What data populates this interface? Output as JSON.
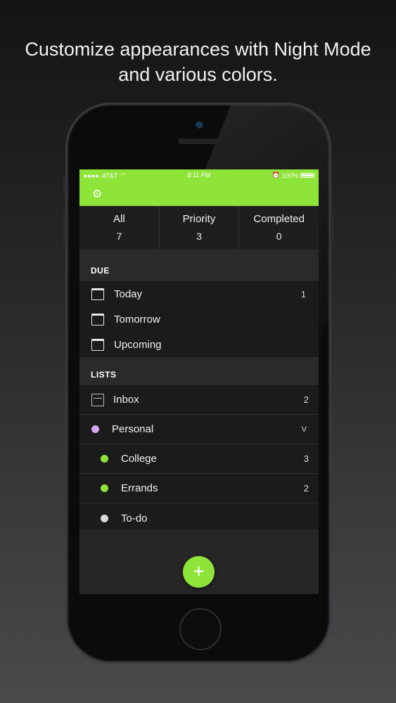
{
  "headline": {
    "line1": "Customize appearances with Night Mode",
    "line2": "and various colors."
  },
  "status_bar": {
    "signal": "●●●●",
    "carrier": "AT&T",
    "wifi_icon": "wifi-icon",
    "time": "8:11 PM",
    "alarm_icon": "alarm-icon",
    "battery": "100%"
  },
  "app_bar": {
    "settings_icon": "⚙"
  },
  "filters": [
    {
      "label": "All",
      "count": "7"
    },
    {
      "label": "Priority",
      "count": "3"
    },
    {
      "label": "Completed",
      "count": "0"
    }
  ],
  "due": {
    "header": "DUE",
    "items": [
      {
        "label": "Today",
        "count": "1"
      },
      {
        "label": "Tomorrow",
        "count": ""
      },
      {
        "label": "Upcoming",
        "count": ""
      }
    ]
  },
  "lists": {
    "header": "LISTS",
    "items": [
      {
        "label": "Inbox",
        "count": "2"
      },
      {
        "label": "Personal",
        "chevron": "V",
        "color": "#d9a6f2"
      },
      {
        "label": "College",
        "count": "3",
        "color": "#8fe43a"
      },
      {
        "label": "Errands",
        "count": "2",
        "color": "#8fe43a"
      },
      {
        "label": "To-do",
        "count": "",
        "color": "#d8d8d8"
      }
    ]
  },
  "fab_label": "+",
  "colors": {
    "accent": "#8fe43a",
    "background": "#1c1c1d"
  }
}
